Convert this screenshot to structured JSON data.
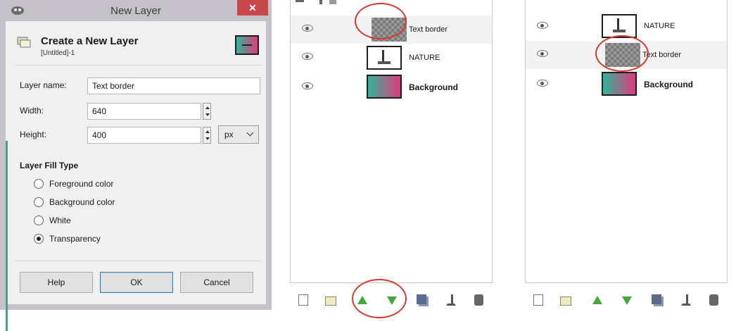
{
  "dialog": {
    "title": "New Layer",
    "close_label": "✕",
    "header_title": "Create a New Layer",
    "header_subtitle": "[Untitled]-1",
    "fields": {
      "name_label": "Layer name:",
      "name_value": "Text border",
      "width_label": "Width:",
      "width_value": "640",
      "height_label": "Height:",
      "height_value": "400",
      "unit": "px"
    },
    "fill_heading": "Layer Fill Type",
    "fill_options": [
      "Foreground color",
      "Background color",
      "White",
      "Transparency"
    ],
    "selected_fill": "Transparency",
    "buttons": {
      "help": "Help",
      "ok": "OK",
      "cancel": "Cancel"
    }
  },
  "panel1": {
    "layers": [
      {
        "name": "Text border",
        "thumb": "transparent-checker"
      },
      {
        "name": "NATURE",
        "thumb": "text-nature"
      },
      {
        "name": "Background",
        "thumb": "gradient"
      }
    ]
  },
  "panel2": {
    "layers": [
      {
        "name": "NATURE",
        "thumb": "text-nature"
      },
      {
        "name": "Text border",
        "thumb": "transparent-checker"
      },
      {
        "name": "Background",
        "thumb": "gradient"
      }
    ]
  },
  "toolbar_icons": [
    "new-layer-icon",
    "layer-group-icon",
    "raise-layer-icon",
    "lower-layer-icon",
    "duplicate-layer-icon",
    "anchor-layer-icon",
    "delete-layer-icon"
  ],
  "colors": {
    "gradient_start": "#2fb59a",
    "gradient_end": "#e2397d",
    "highlight_circle": "#d63a2f",
    "accent_edge": "#4f9d8d"
  }
}
